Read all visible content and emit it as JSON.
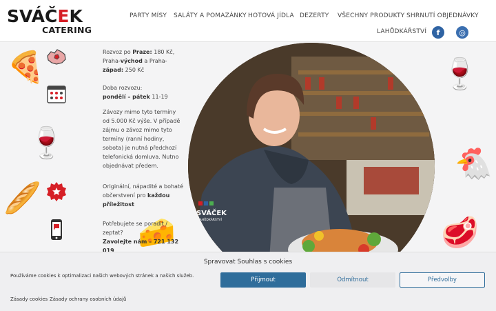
{
  "logo": {
    "top_dark": "SVÁČ",
    "top_red": "E",
    "top_dark2": "K",
    "bottom": "CATERING"
  },
  "nav": {
    "items": [
      {
        "label": "PARTY MÍSY"
      },
      {
        "label": "SALÁTY A POMAZÁNKY"
      },
      {
        "label": "HOTOVÁ JÍDLA"
      },
      {
        "label": "DEZERTY"
      },
      {
        "label": "VŠECHNY PRODUKTY"
      },
      {
        "label": "SHRNUTÍ OBJEDNÁVKY"
      },
      {
        "label": "LAHŮDKÁŘSTVÍ"
      }
    ],
    "social": [
      {
        "icon": "facebook-icon",
        "glyph": "f"
      },
      {
        "icon": "instagram-icon",
        "glyph": "◎"
      }
    ]
  },
  "info": {
    "delivery": {
      "icon": "prague-map-icon",
      "pre": "Rozvoz po ",
      "b1": "Praze:",
      "t1": " 180 Kč, Praha-",
      "b2": "východ",
      "t2": " a Praha-",
      "b3": "západ:",
      "t3": " 250 Kč"
    },
    "time": {
      "icon": "calendar-icon",
      "line1": "Doba rozvozu:",
      "b1": "pondělí – pátek",
      "t1": " 11-19",
      "extra": "Závozy mimo tyto termíny od 5.000 Kč výše. V případě zájmu o závoz mimo tyto termíny (ranní hodiny, sobota) je nutná předchozí telefonická domluva. Nutno objednávat předem."
    },
    "quality": {
      "icon": "star-badge-icon",
      "t1": "Originální, nápadité a bohaté občerstvení pro ",
      "b1": "každou příležitost"
    },
    "contact": {
      "icon": "phone-icon",
      "t1": "Potřebujete se poradit / zeptat?",
      "b1": "Zavolejte nám – 721 132 019"
    }
  },
  "photo": {
    "apron_brand": "SVÁČEK",
    "apron_sub": "LAHŮDKÁŘSTVÍ"
  },
  "cookie": {
    "title": "Spravovat Souhlas s cookies",
    "text": "Používáme cookies k optimalizaci našich webových stránek a našich služeb.",
    "accept": "Přijmout",
    "deny": "Odmítnout",
    "prefs": "Předvolby",
    "link1": "Zásady cookies",
    "link2": "Zásady ochrany osobních údajů"
  },
  "colors": {
    "brand_red": "#d61f26",
    "accent_blue": "#2f6d9b",
    "social_blue": "#2f63a3"
  }
}
